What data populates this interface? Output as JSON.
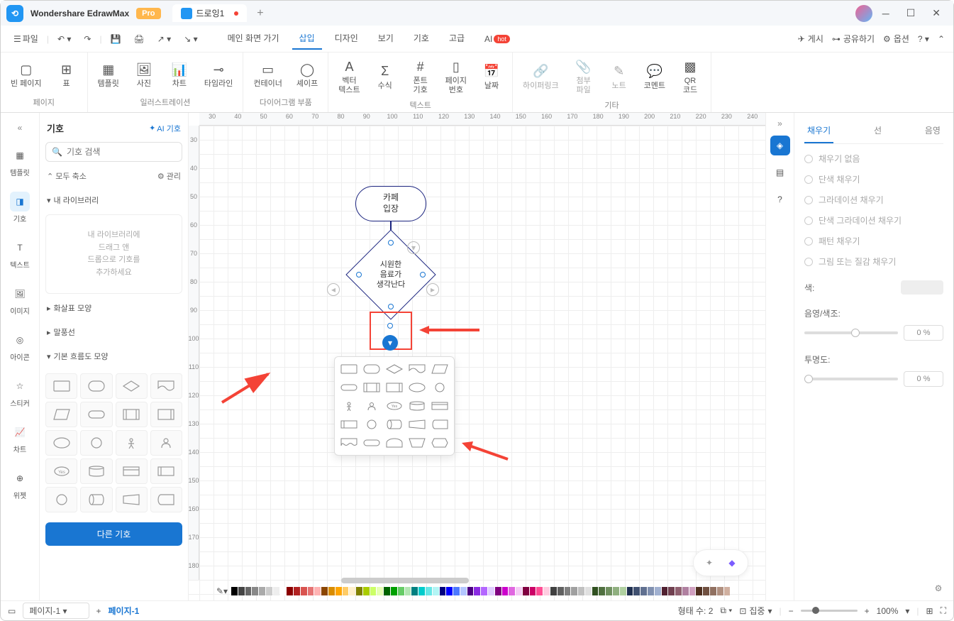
{
  "app": {
    "name": "Wondershare EdrawMax",
    "badge": "Pro"
  },
  "doc_tab": "드로잉1",
  "menu_tabs": [
    "메인 화면 가기",
    "삽입",
    "디자인",
    "보기",
    "기호",
    "고급"
  ],
  "menu_active": "삽입",
  "ai_label": "AI",
  "ai_badge": "hot",
  "menu_right": {
    "publish": "게시",
    "share": "공유하기",
    "options": "옵션"
  },
  "file_label": "파일",
  "ribbon": {
    "page": {
      "blank": "빈 페이지",
      "table": "표",
      "label": "페이지"
    },
    "illustration": {
      "template": "템플릿",
      "photo": "사진",
      "chart": "차트",
      "timeline": "타임라인",
      "label": "일러스트레이션"
    },
    "diagram": {
      "container": "컨테이너",
      "shape": "셰이프",
      "label": "다이어그램 부품"
    },
    "text": {
      "vector": "벡터\n텍스트",
      "formula": "수식",
      "font": "폰트\n기호",
      "pagenum": "페이지\n번호",
      "date": "날짜",
      "label": "텍스트"
    },
    "etc": {
      "hyperlink": "하이퍼링크",
      "attach": "첨부\n파일",
      "note": "노트",
      "comment": "코멘트",
      "qr": "QR\n코드",
      "label": "기타"
    }
  },
  "left_rail": {
    "template": "템플릿",
    "symbol": "기호",
    "text": "텍스트",
    "image": "이미지",
    "icon": "아이콘",
    "sticker": "스티커",
    "chart": "차트",
    "widget": "위젯"
  },
  "left_panel": {
    "title": "기호",
    "ai_symbols": "AI 기호",
    "search_placeholder": "기호 검색",
    "collapse_all": "모두 축소",
    "manage": "관리",
    "my_library": "내 라이브러리",
    "library_hint": "내 라이브러리에\n드래그 앤\n드롭으로 기호를\n추가하세요",
    "arrow_shapes": "화살표 모양",
    "speech": "말풍선",
    "basic_flow": "기본 흐름도 모양",
    "more_shapes": "다른 기호"
  },
  "ruler_h": [
    "30",
    "40",
    "50",
    "60",
    "70",
    "80",
    "90",
    "100",
    "110",
    "120",
    "130",
    "140",
    "150",
    "160",
    "170",
    "180",
    "190",
    "200",
    "210",
    "220",
    "230",
    "240"
  ],
  "ruler_v": [
    "30",
    "40",
    "50",
    "60",
    "70",
    "80",
    "90",
    "100",
    "110",
    "120",
    "130",
    "140",
    "150",
    "160",
    "170",
    "180"
  ],
  "flowchart": {
    "start": "카페\n입장",
    "decision": "시원한\n음료가\n생각난다"
  },
  "right_panel": {
    "tabs": [
      "채우기",
      "선",
      "음영"
    ],
    "active": "채우기",
    "options": [
      "채우기 없음",
      "단색 채우기",
      "그라데이션 채우기",
      "단색 그라데이션 채우기",
      "패턴 채우기",
      "그림 또는 질감 채우기"
    ],
    "color_label": "색:",
    "shade_label": "음영/색조:",
    "opacity_label": "투명도:",
    "shade_val": "0 %",
    "opacity_val": "0 %"
  },
  "status": {
    "page_select": "페이지-1",
    "page_name": "페이지-1",
    "shape_count": "형태 수: 2",
    "focus": "집중",
    "zoom": "100%"
  },
  "palette_colors": [
    "#000",
    "#444",
    "#666",
    "#888",
    "#aaa",
    "#ccc",
    "#eee",
    "#fff",
    "#8b0000",
    "#b22222",
    "#d9534f",
    "#e57373",
    "#ffb3b3",
    "#8b4500",
    "#d98c00",
    "#ffa500",
    "#ffcc66",
    "#fff0cc",
    "#808000",
    "#aacc00",
    "#ccff66",
    "#e6ffb3",
    "#006400",
    "#00a000",
    "#66cc66",
    "#b3e6b3",
    "#008080",
    "#00cccc",
    "#66e6e6",
    "#b3f5f5",
    "#000080",
    "#0000ff",
    "#4d79ff",
    "#b3c6ff",
    "#4b0082",
    "#8a2be2",
    "#b366ff",
    "#e0ccff",
    "#800080",
    "#cc00cc",
    "#e066e0",
    "#f5ccf5",
    "#800040",
    "#cc0066",
    "#ff4d94",
    "#ffcce0",
    "#404040",
    "#606060",
    "#808080",
    "#a0a0a0",
    "#c0c0c0",
    "#e0e0e0",
    "#305020",
    "#507040",
    "#709060",
    "#90b080",
    "#b0d0a0",
    "#203050",
    "#405070",
    "#607090",
    "#8090b0",
    "#a0b0d0",
    "#502030",
    "#704050",
    "#906070",
    "#b080a0",
    "#d0a0c0",
    "#503020",
    "#705040",
    "#907060",
    "#b09080",
    "#d0b0a0"
  ]
}
